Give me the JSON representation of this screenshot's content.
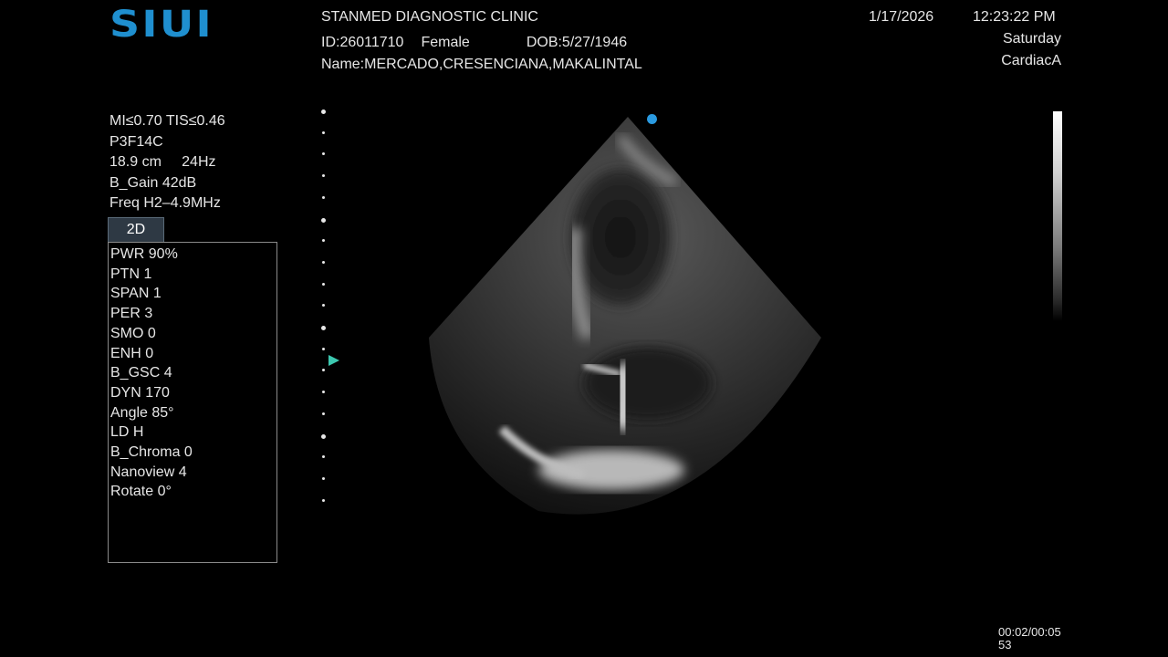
{
  "brand": {
    "logo_text": "SIUI",
    "logo_color": "#1f8fcf"
  },
  "header": {
    "clinic": "STANMED DIAGNOSTIC CLINIC",
    "patient_id": "ID:26011710",
    "sex": "Female",
    "dob": "DOB:5/27/1946",
    "name": "Name:MERCADO,CRESENCIANA,MAKALINTAL",
    "date": "1/17/2026",
    "time": "12:23:22 PM",
    "day": "Saturday",
    "preset": "CardiacA"
  },
  "imaging_params": {
    "mi_tis": "MI≤0.70 TIS≤0.46",
    "probe": "P3F14C",
    "depth_rate": "18.9 cm     24Hz",
    "gain": "B_Gain 42dB",
    "freq": "Freq H2–4.9MHz"
  },
  "mode_tab": {
    "label": "2D"
  },
  "panel_items": [
    "PWR 90%",
    "PTN 1",
    "SPAN 1",
    "PER 3",
    "SMO 0",
    "ENH 0",
    "B_GSC 4",
    "DYN 170",
    "Angle 85°",
    "LD H",
    "B_Chroma 0",
    "Nanoview 4",
    "Rotate 0°"
  ],
  "cine": {
    "line1": "00:02/00:05",
    "line2": "53"
  },
  "colors": {
    "focus_marker": "#3cc8b0",
    "probe_orientation": "#2a9ae0",
    "tab_bg": "#2e3944"
  },
  "icons": {
    "focus": "focus-marker-icon",
    "orientation": "probe-orientation-dot-icon"
  }
}
